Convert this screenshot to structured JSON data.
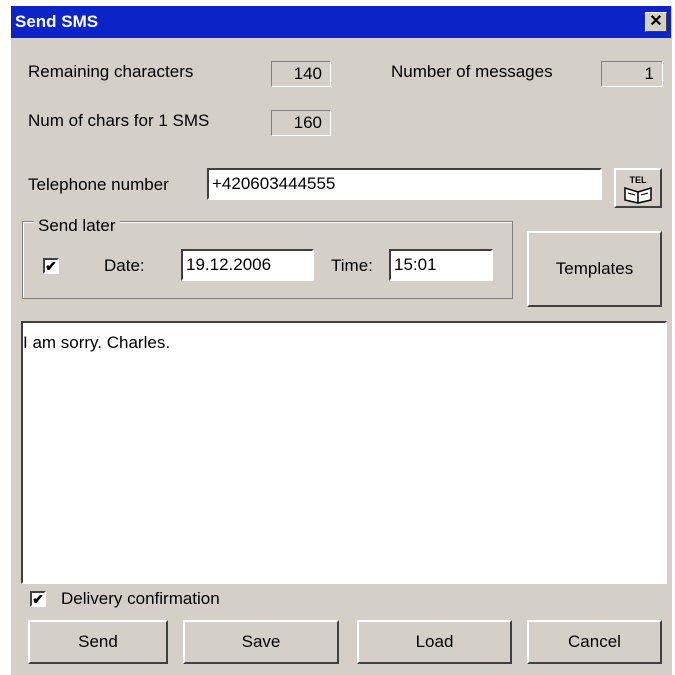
{
  "window": {
    "title": "Send SMS",
    "close_glyph": "✕"
  },
  "counters": {
    "remaining_label": "Remaining characters",
    "remaining_value": "140",
    "messages_label": "Number of messages",
    "messages_value": "1",
    "chars_per_sms_label": "Num of chars for 1 SMS",
    "chars_per_sms_value": "160"
  },
  "phone": {
    "label": "Telephone number",
    "value": "+420603444555",
    "phonebook_icon_text": "TEL"
  },
  "send_later": {
    "legend": "Send later",
    "checked": true,
    "check_glyph": "✔",
    "date_label": "Date:",
    "date_value": "19.12.2006",
    "time_label": "Time:",
    "time_value": "15:01"
  },
  "templates_button": "Templates",
  "message": {
    "text": "I am sorry. Charles."
  },
  "delivery_confirmation": {
    "label": "Delivery confirmation",
    "checked": true,
    "check_glyph": "✔"
  },
  "buttons": {
    "send": "Send",
    "save": "Save",
    "load": "Load",
    "cancel": "Cancel"
  }
}
